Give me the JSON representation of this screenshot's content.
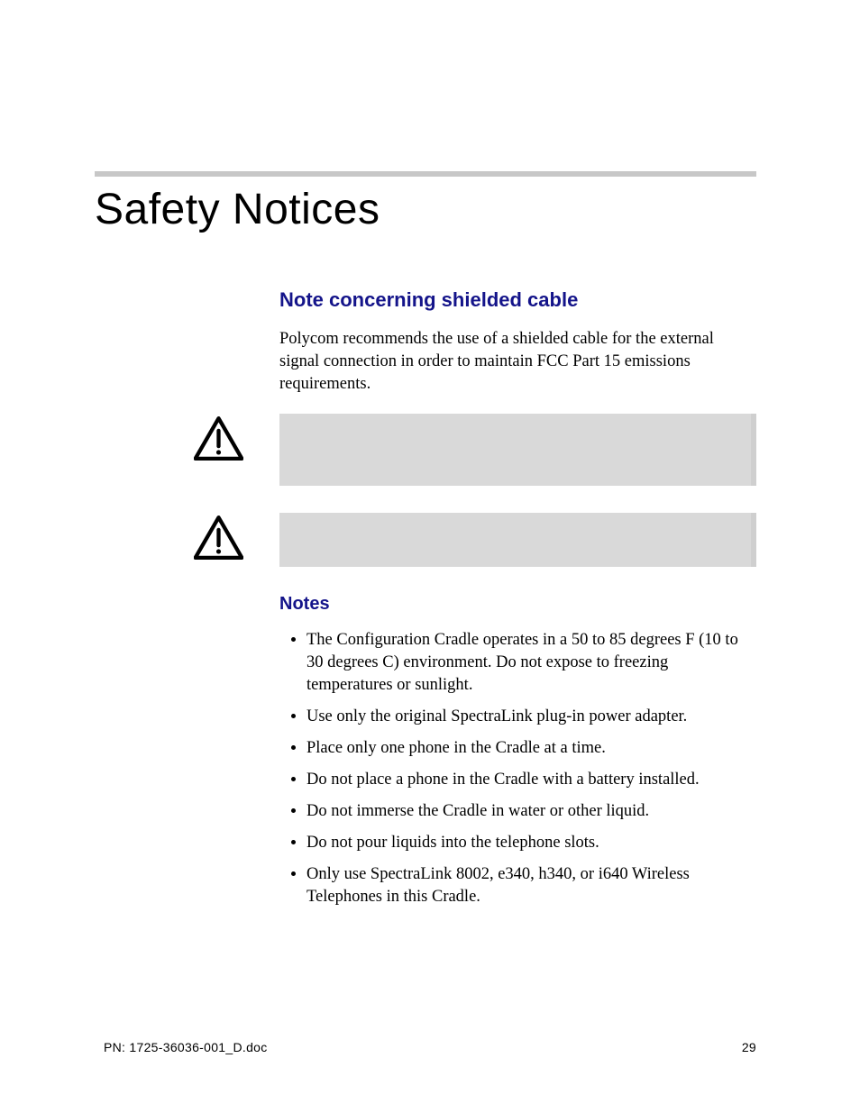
{
  "title": "Safety Notices",
  "section1": {
    "heading": "Note concerning shielded cable",
    "paragraph": "Polycom recommends the use of a shielded cable for the external signal connection in order to maintain FCC Part 15 emissions requirements."
  },
  "warnings": [
    {
      "icon": "warning-triangle",
      "text": ""
    },
    {
      "icon": "warning-triangle",
      "text": ""
    }
  ],
  "section2": {
    "heading": "Notes",
    "items": [
      "The Configuration Cradle operates in a 50 to 85 degrees F (10 to 30 degrees C) environment. Do not expose to freezing temperatures or sunlight.",
      "Use only the original SpectraLink plug-in power adapter.",
      "Place only one phone in the Cradle at a time.",
      "Do not place a phone in the Cradle with a battery installed.",
      "Do not immerse the Cradle in water or other liquid.",
      "Do not pour liquids into the telephone slots.",
      "Only use SpectraLink 8002, e340, h340, or i640 Wireless Telephones in this Cradle."
    ]
  },
  "footer": {
    "left": "PN: 1725-36036-001_D.doc",
    "right": "29"
  }
}
